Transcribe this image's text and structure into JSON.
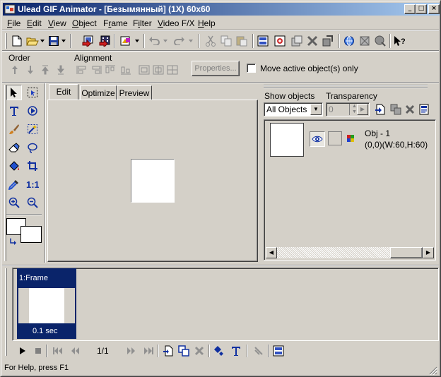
{
  "window": {
    "title": "Ulead GIF Animator - [Безымянный] (1X) 60x60",
    "minimize": "_",
    "maximize": "□",
    "close": "×"
  },
  "menu": [
    {
      "label": "File",
      "key": "F"
    },
    {
      "label": "Edit",
      "key": "E"
    },
    {
      "label": "View",
      "key": "V"
    },
    {
      "label": "Object",
      "key": "O"
    },
    {
      "label": "Frame",
      "key": "r"
    },
    {
      "label": "Filter",
      "key": "i"
    },
    {
      "label": "Video F/X",
      "key": "V"
    },
    {
      "label": "Help",
      "key": "H"
    }
  ],
  "toolbar": {
    "icons": [
      "new-file-icon",
      "open-file-icon",
      "save-icon",
      "add-images-icon",
      "add-video-icon",
      "optimize-icon",
      "undo-icon",
      "redo-icon",
      "cut-icon",
      "copy-icon",
      "paste-icon",
      "frame-properties-icon",
      "add-frame-icon",
      "delete-frame-icon",
      "tween-icon",
      "duplicate-frame-icon",
      "reverse-frame-icon",
      "preview-browser-icon",
      "crop-icon",
      "resize-icon",
      "context-help-icon"
    ]
  },
  "objectbar": {
    "order_label": "Order",
    "alignment_label": "Alignment",
    "properties_button": "Properties...",
    "move_active_checkbox": "Move active object(s) only"
  },
  "tabs": [
    "Edit",
    "Optimize",
    "Preview"
  ],
  "object_manager": {
    "show_objects_label": "Show objects",
    "transparency_label": "Transparency",
    "show_objects_value": "All Objects",
    "transparency_value": "0",
    "object": {
      "name": "Obj - 1",
      "info": "(0,0)(W:60,H:60)"
    }
  },
  "frame_panel": {
    "frame_label": "1:Frame",
    "frame_delay": "0.1 sec",
    "frame_counter": "1/1"
  },
  "status": {
    "text": "For Help, press F1"
  },
  "colors": {
    "face": "#d4d0c8",
    "title_start": "#0a246a",
    "title_end": "#a6caf0",
    "frame_selected": "#0a246a"
  }
}
